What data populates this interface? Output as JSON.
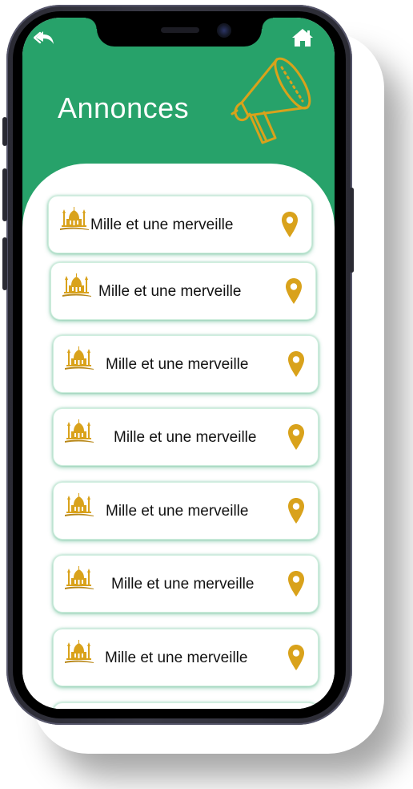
{
  "header": {
    "title": "Annonces",
    "color": "#27a26a"
  },
  "icons": {
    "back": "double-chevron-back-icon",
    "home": "home-icon",
    "megaphone": "megaphone-icon",
    "item_icon": "mosque-icon",
    "location": "map-pin-icon"
  },
  "accent_color": "#d9a21b",
  "items": [
    {
      "label": "Mille et une merveille"
    },
    {
      "label": "Mille et une merveille"
    },
    {
      "label": "Mille et une merveille"
    },
    {
      "label": "Mille et une merveille"
    },
    {
      "label": "Mille et une merveille"
    },
    {
      "label": "Mille et une merveille"
    },
    {
      "label": "Mille et une merveille"
    }
  ]
}
